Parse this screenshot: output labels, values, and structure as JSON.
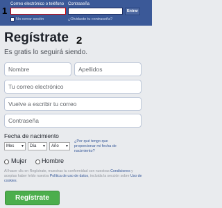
{
  "header": {
    "email_label": "Correo electrónico o teléfono",
    "password_label": "Contraseña",
    "login_button": "Entrar",
    "remember_label": "No cerrar sesión",
    "forgot_link": "¿Olvidaste tu contraseña?"
  },
  "annotations": {
    "one": "1",
    "two": "2"
  },
  "signup": {
    "title": "Regístrate",
    "subtitle": "Es gratis lo seguirá siendo.",
    "first_name_placeholder": "Nombre",
    "last_name_placeholder": "Apellidos",
    "email_placeholder": "Tu correo electrónico",
    "email_confirm_placeholder": "Vuelve a escribir tu correo",
    "password_placeholder": "Contraseña",
    "birthday_label": "Fecha de nacimiento",
    "day_select": "Mes",
    "month_select": "Día",
    "year_select": "Año",
    "why_birthday_link": "¿Por qué tengo que proporcionar mi fecha de nacimiento?",
    "female_label": "Mujer",
    "male_label": "Hombre",
    "terms_prefix": "Al hacer clic en Regístrate, muestras tu conformidad con nuestras ",
    "terms_link_conditions": "Condiciones",
    "terms_middle": " y aceptas haber leído nuestra ",
    "terms_link_data": "Política de uso de datos",
    "terms_middle2": ", incluida la sección sobre ",
    "terms_link_cookies": "Uso de cookies",
    "terms_suffix": ".",
    "submit_button": "Regístrate"
  },
  "colors": {
    "brand": "#3b5998",
    "signup_green": "#4cae4c",
    "link": "#365899"
  }
}
